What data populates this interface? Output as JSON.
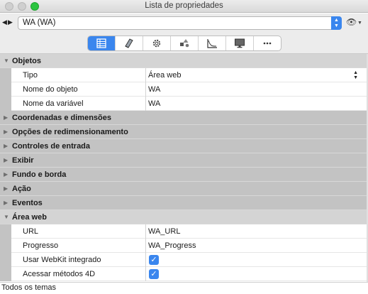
{
  "window": {
    "title": "Lista de propriedades"
  },
  "selector": {
    "value": "WA (WA)"
  },
  "tabs": [
    {
      "icon": "list-icon",
      "active": true
    },
    {
      "icon": "book-icon",
      "active": false
    },
    {
      "icon": "gear-icon",
      "active": false
    },
    {
      "icon": "shapes-icon",
      "active": false
    },
    {
      "icon": "graph-icon",
      "active": false
    },
    {
      "icon": "monitor-icon",
      "active": false
    },
    {
      "icon": "more-icon",
      "active": false
    }
  ],
  "sections": {
    "objetos": {
      "label": "Objetos",
      "props": {
        "tipo": {
          "label": "Tipo",
          "value": "Área web"
        },
        "nome_objeto": {
          "label": "Nome do objeto",
          "value": "WA"
        },
        "nome_variavel": {
          "label": "Nome da variável",
          "value": "WA"
        }
      }
    },
    "coord": {
      "label": "Coordenadas e dimensões"
    },
    "redim": {
      "label": "Opções de redimensionamento"
    },
    "entrada": {
      "label": "Controles de entrada"
    },
    "exibir": {
      "label": "Exibir"
    },
    "fundo": {
      "label": "Fundo e borda"
    },
    "acao": {
      "label": "Ação"
    },
    "eventos": {
      "label": "Eventos"
    },
    "areaweb": {
      "label": "Área web",
      "props": {
        "url": {
          "label": "URL",
          "value": "WA_URL"
        },
        "progresso": {
          "label": "Progresso",
          "value": "WA_Progress"
        },
        "webkit": {
          "label": "Usar WebKit integrado",
          "checked": true
        },
        "metodos4d": {
          "label": "Acessar métodos 4D",
          "checked": true
        }
      }
    }
  },
  "footer": {
    "text": "Todos os temas"
  },
  "colors": {
    "accent": "#3a86ee",
    "category_bg": "#c3c3c3",
    "close_green": "#2bc43f"
  }
}
